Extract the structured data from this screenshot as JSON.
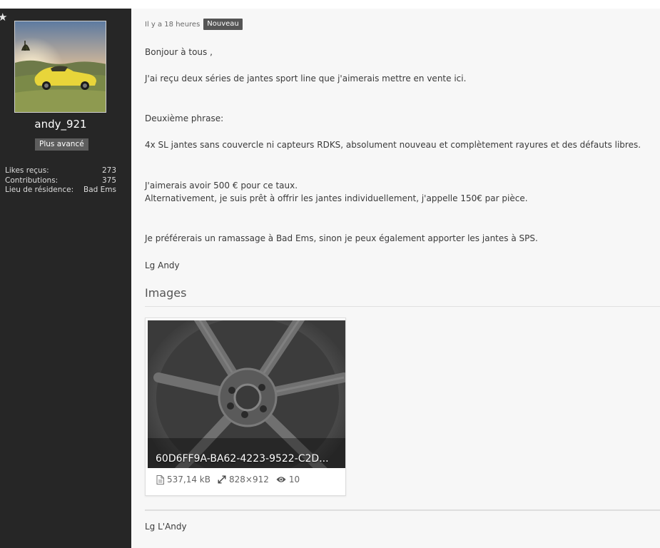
{
  "sidebar": {
    "username": "andy_921",
    "rank": "Plus avancé",
    "stats": [
      {
        "label": "Likes reçus:",
        "value": "273"
      },
      {
        "label": "Contributions:",
        "value": "375"
      },
      {
        "label": "Lieu de résidence:",
        "value": "Bad Ems"
      }
    ]
  },
  "post": {
    "time": "Il y a 18 heures",
    "badge": "Nouveau",
    "greeting": "Bonjour à tous ,",
    "line1": "J'ai reçu deux séries de jantes sport line que j'aimerais mettre en vente ici.",
    "line2": "Deuxième phrase:",
    "line3": "4x SL jantes sans couvercle ni capteurs RDKS, absolument nouveau et complètement rayures et des défauts libres.",
    "line4": "J'aimerais avoir 500 € pour ce taux.",
    "line5": "Alternativement, je suis prêt à offrir les jantes individuellement, j'appelle 150€ par pièce.",
    "line6": "Je préférerais un ramassage à Bad Ems, sinon je peux également apporter les jantes à SPS.",
    "signoff": "Lg Andy",
    "images_heading": "Images",
    "signature": "Lg L'Andy"
  },
  "attachment": {
    "name": "60D6FF9A-BA62-4223-9522-C2D...",
    "size": "537,14 kB",
    "dimensions": "828×912",
    "views": "10"
  },
  "colors": {
    "sidebar_bg": "#262626",
    "badge_bg": "#555555",
    "rank_bg": "#5d5d5d",
    "content_bg": "#f7f7f7"
  },
  "icons": [
    "star-icon",
    "file-icon",
    "resize-icon",
    "eye-icon"
  ]
}
